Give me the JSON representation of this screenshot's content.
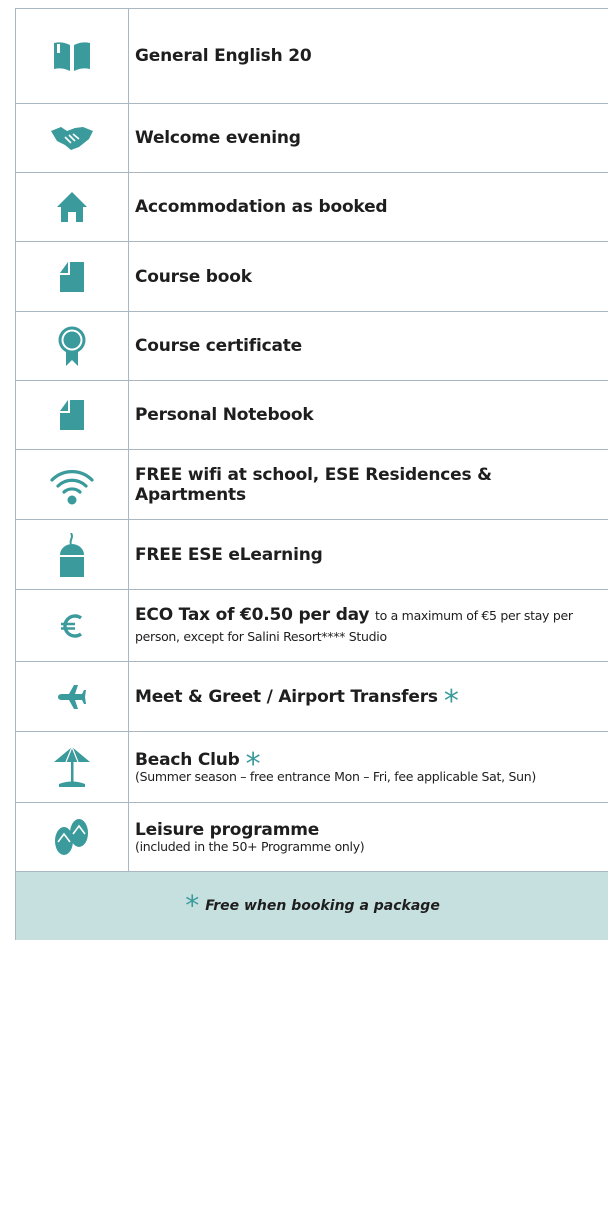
{
  "colors": {
    "icon": "#3a9a9c",
    "footer_bg": "#c6e0df",
    "border": "#a9b7c3"
  },
  "rows": [
    {
      "icon": "book-icon",
      "title": "General English 20"
    },
    {
      "icon": "handshake-icon",
      "title": "Welcome evening"
    },
    {
      "icon": "house-icon",
      "title": "Accommodation as booked"
    },
    {
      "icon": "document-icon",
      "title": "Course book"
    },
    {
      "icon": "award-ribbon-icon",
      "title": "Course certificate"
    },
    {
      "icon": "document-icon",
      "title": "Personal Notebook"
    },
    {
      "icon": "wifi-icon",
      "title": "FREE wifi at school, ESE Residences & Apartments"
    },
    {
      "icon": "mouse-icon",
      "title": "FREE ESE eLearning"
    },
    {
      "icon": "euro-icon",
      "title": "ECO Tax of €0.50 per day",
      "note": "to a maximum of €5 per stay per person, except for Salini Resort**** Studio"
    },
    {
      "icon": "airplane-icon",
      "title": "Meet & Greet / Airport Transfers",
      "star": "*"
    },
    {
      "icon": "beach-umbrella-icon",
      "title": "Beach Club",
      "star": "*",
      "note": "(Summer season – free entrance Mon – Fri, fee applicable Sat, Sun)"
    },
    {
      "icon": "flip-flops-icon",
      "title": "Leisure programme",
      "note": "(included in the 50+ Programme only)"
    }
  ],
  "footer": {
    "star": "*",
    "text": "Free when booking a package"
  }
}
